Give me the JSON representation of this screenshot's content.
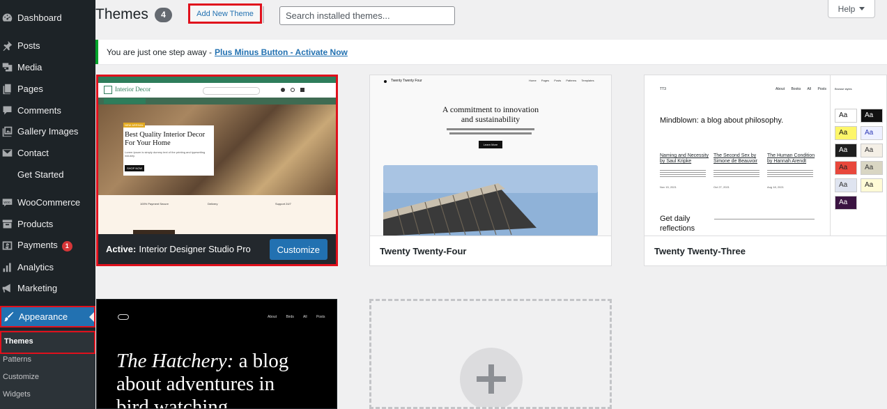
{
  "sidebar": {
    "items": [
      {
        "key": "dashboard",
        "label": "Dashboard",
        "icon": "dashboard-icon"
      },
      {
        "key": "posts",
        "label": "Posts",
        "icon": "pin-icon"
      },
      {
        "key": "media",
        "label": "Media",
        "icon": "media-icon"
      },
      {
        "key": "pages",
        "label": "Pages",
        "icon": "pages-icon"
      },
      {
        "key": "comments",
        "label": "Comments",
        "icon": "comment-icon"
      },
      {
        "key": "gallery",
        "label": "Gallery Images",
        "icon": "gallery-icon"
      },
      {
        "key": "contact",
        "label": "Contact",
        "icon": "mail-icon"
      },
      {
        "key": "get_started",
        "label": "Get Started",
        "icon": ""
      },
      {
        "key": "woocommerce",
        "label": "WooCommerce",
        "icon": "woo-icon"
      },
      {
        "key": "products",
        "label": "Products",
        "icon": "archive-icon"
      },
      {
        "key": "payments",
        "label": "Payments",
        "icon": "dollar-icon",
        "badge": "1"
      },
      {
        "key": "analytics",
        "label": "Analytics",
        "icon": "bar-chart-icon"
      },
      {
        "key": "marketing",
        "label": "Marketing",
        "icon": "megaphone-icon"
      },
      {
        "key": "appearance",
        "label": "Appearance",
        "icon": "brush-icon"
      }
    ],
    "submenu": [
      {
        "key": "themes",
        "label": "Themes"
      },
      {
        "key": "patterns",
        "label": "Patterns"
      },
      {
        "key": "customize",
        "label": "Customize"
      },
      {
        "key": "widgets",
        "label": "Widgets"
      }
    ]
  },
  "header": {
    "title": "Themes",
    "count": "4",
    "add_new_label": "Add New Theme",
    "search_placeholder": "Search installed themes...",
    "help_label": "Help"
  },
  "notice": {
    "text": "You are just one step away -",
    "link": "Plus Minus Button - Activate Now"
  },
  "themes": {
    "active": {
      "prefix": "Active:",
      "name": "Interior Designer Studio Pro",
      "customize_label": "Customize",
      "preview": {
        "logo": "Interior Decor",
        "hero_tag": "NEW ARRIVAL",
        "hero_title_1": "Best Quality Interior Decor",
        "hero_title_2": "For Your Home",
        "hero_text": "Lorem Ipsum is simply dummy text of the printing and typesetting industry.",
        "hero_button": "SHOP NOW",
        "features": [
          "100% Payment Secure",
          "Delivery",
          "Support 24/7"
        ]
      }
    },
    "t24": {
      "name": "Twenty Twenty-Four",
      "preview": {
        "site": "Twenty Twenty Four",
        "nav": [
          "Home",
          "Pages",
          "Posts",
          "Patterns",
          "Templates"
        ],
        "headline_1": "A commitment to innovation",
        "headline_2": "and sustainability",
        "button": "Learn More"
      }
    },
    "t23": {
      "name": "Twenty Twenty-Three",
      "preview": {
        "site": "TT3",
        "nav": [
          "About",
          "Books",
          "All Posts"
        ],
        "headline": "Mindblown: a blog about philosophy.",
        "posts": [
          {
            "title": "Naming and Necessity by Saul Kripke",
            "date": "Nov 15, 2021"
          },
          {
            "title": "The Second Sex by Simone de Beauvoir",
            "date": "Oct 27, 2021"
          },
          {
            "title": "The Human Condition by Hannah Arendt",
            "date": "Aug 18, 2021"
          }
        ],
        "footer_heading": "Get daily reflections",
        "styles_label": "Browse styles",
        "swatch": "Aa"
      }
    },
    "hatchery": {
      "preview": {
        "nav": [
          "About",
          "Birds",
          "All Posts"
        ],
        "headline_italic": "The Hatchery:",
        "headline_rest_1": " a blog",
        "headline_line_2": "about adventures in",
        "headline_line_3": "bird watching"
      }
    }
  },
  "colors": {
    "sidebar_bg": "#1d2327",
    "accent": "#2271b1",
    "highlight_border": "#e0101c",
    "notice_border": "#00a32a",
    "badge": "#d63638"
  }
}
